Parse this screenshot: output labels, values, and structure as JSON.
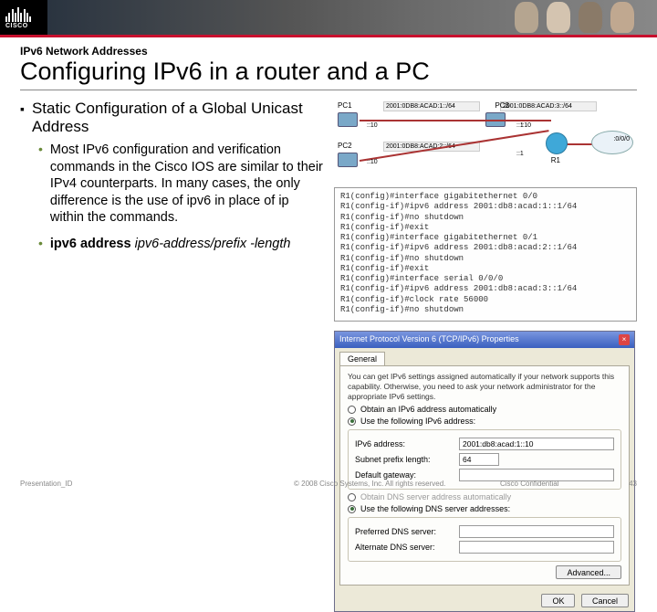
{
  "brand": {
    "name": "CISCO"
  },
  "header": {
    "kicker": "IPv6 Network Addresses",
    "title": "Configuring IPv6 in a router and a PC"
  },
  "bullets": {
    "main": "Static Configuration of a Global Unicast Address",
    "sub1": "Most IPv6 configuration and verification commands in the Cisco IOS are similar to their IPv4 counterparts. In many cases, the only difference is the use of ipv6 in place of ip within the commands.",
    "sub2_prefix": "ipv6 address ",
    "sub2_italic": "ipv6-address/prefix -length"
  },
  "diagram": {
    "pc1": "PC1",
    "pc2": "PC2",
    "pc3": "PC3",
    "router": "R1",
    "net1": "2001:0DB8:ACAD:1::/64",
    "net2": "2001:0DB8:ACAD:2::/64",
    "net3": "2001:0DB8:ACAD:3::/64",
    "addr10a": "::10",
    "addr10b": "::10",
    "addr10c": "::10",
    "ifc1": "::1",
    "ifc2": "::1",
    "serial": ":0/0/0"
  },
  "cli": {
    "l1": "R1(config)#interface gigabitethernet 0/0",
    "l2": "R1(config-if)#ipv6 address 2001:db8:acad:1::1/64",
    "l3": "R1(config-if)#no shutdown",
    "l4": "R1(config-if)#exit",
    "l5": "R1(config)#interface gigabitethernet 0/1",
    "l6": "R1(config-if)#ipv6 address 2001:db8:acad:2::1/64",
    "l7": "R1(config-if)#no shutdown",
    "l8": "R1(config-if)#exit",
    "l9": "R1(config)#interface serial 0/0/0",
    "l10": "R1(config-if)#ipv6 address 2001:db8:acad:3::1/64",
    "l11": "R1(config-if)#clock rate 56000",
    "l12": "R1(config-if)#no shutdown"
  },
  "dialog": {
    "title": "Internet Protocol Version 6 (TCP/IPv6) Properties",
    "tab": "General",
    "help": "You can get IPv6 settings assigned automatically if your network supports this capability. Otherwise, you need to ask your network administrator for the appropriate IPv6 settings.",
    "opt_auto": "Obtain an IPv6 address automatically",
    "opt_manual": "Use the following IPv6 address:",
    "label_addr": "IPv6 address:",
    "label_prefix": "Subnet prefix length:",
    "label_gw": "Default gateway:",
    "val_addr": "2001:db8:acad:1::10",
    "val_prefix": "64",
    "val_gw": "",
    "dns_auto": "Obtain DNS server address automatically",
    "dns_manual": "Use the following DNS server addresses:",
    "label_dns1": "Preferred DNS server:",
    "label_dns2": "Alternate DNS server:",
    "advanced": "Advanced...",
    "ok": "OK",
    "cancel": "Cancel"
  },
  "footer": {
    "left": "Presentation_ID",
    "center": "© 2008 Cisco Systems, Inc. All rights reserved.",
    "right": "Cisco Confidential",
    "page": "43"
  }
}
